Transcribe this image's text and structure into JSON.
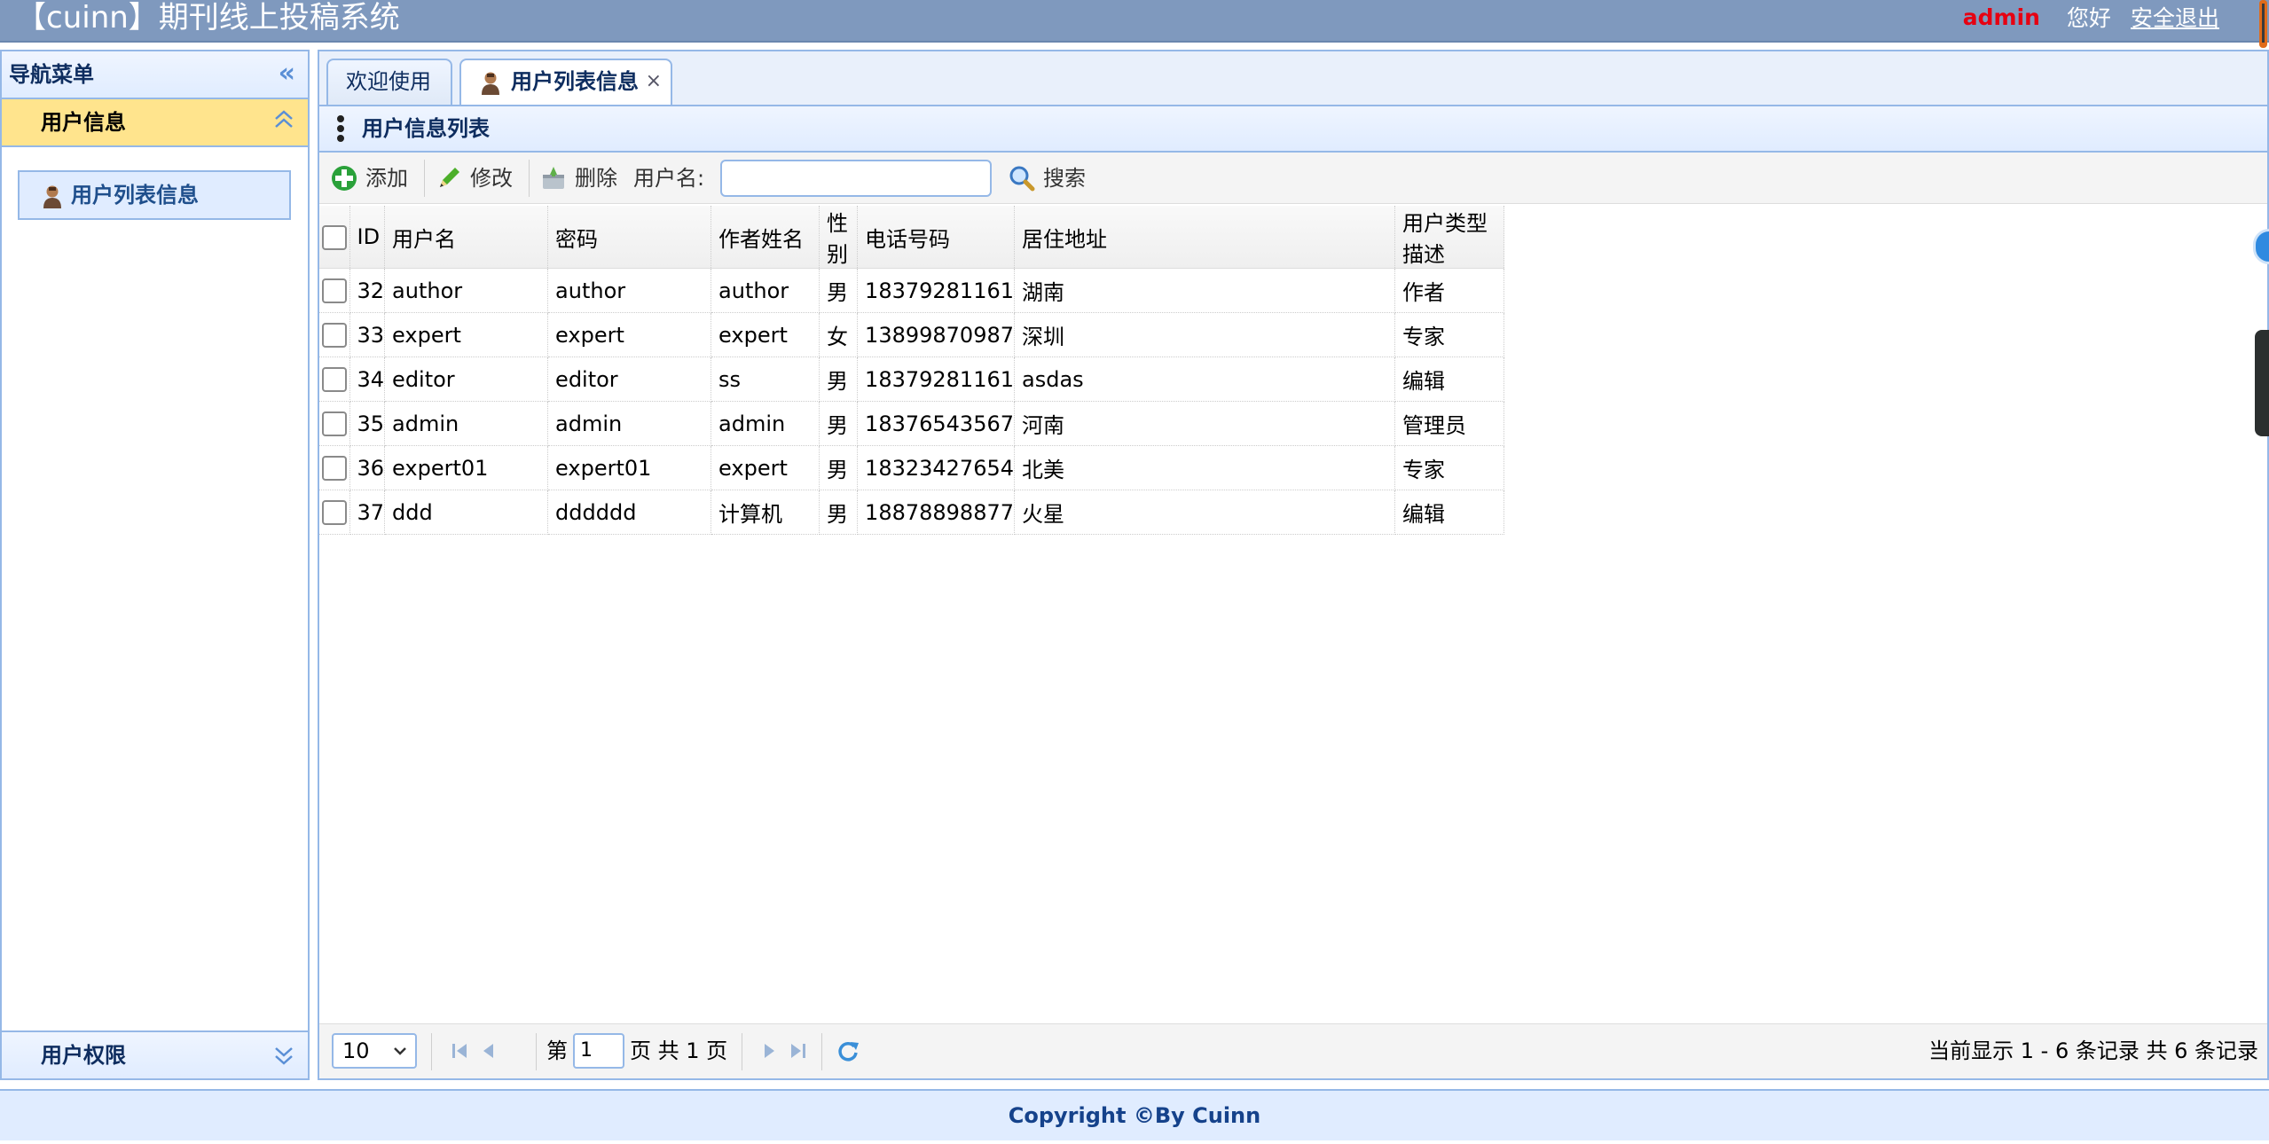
{
  "header": {
    "title": "【cuinn】期刊线上投稿系统",
    "user": "admin",
    "greeting": "您好",
    "logout": "安全退出"
  },
  "nav": {
    "title": "导航菜单",
    "sections": [
      {
        "label": "用户信息",
        "expanded": true,
        "items": [
          {
            "label": "用户列表信息",
            "icon": "user-icon"
          }
        ]
      },
      {
        "label": "用户权限",
        "expanded": false
      }
    ]
  },
  "tabs": [
    {
      "label": "欢迎使用",
      "active": false
    },
    {
      "label": "用户列表信息",
      "active": true,
      "icon": "user-icon",
      "closable": true
    }
  ],
  "panel": {
    "title": "用户信息列表",
    "toolbar": {
      "add": "添加",
      "edit": "修改",
      "delete": "删除",
      "username_label": "用户名:",
      "username_value": "",
      "search": "搜索"
    }
  },
  "grid": {
    "columns": [
      "ID",
      "用户名",
      "密码",
      "作者姓名",
      "性别",
      "电话号码",
      "居住地址",
      "用户类型描述"
    ],
    "rows": [
      [
        "32",
        "author",
        "author",
        "author",
        "男",
        "18379281161",
        "湖南",
        "作者"
      ],
      [
        "33",
        "expert",
        "expert",
        "expert",
        "女",
        "13899870987",
        "深圳",
        "专家"
      ],
      [
        "34",
        "editor",
        "editor",
        "ss",
        "男",
        "18379281161",
        "asdas",
        "编辑"
      ],
      [
        "35",
        "admin",
        "admin",
        "admin",
        "男",
        "18376543567",
        "河南",
        "管理员"
      ],
      [
        "36",
        "expert01",
        "expert01",
        "expert",
        "男",
        "18323427654",
        "北美",
        "专家"
      ],
      [
        "37",
        "ddd",
        "dddddd",
        "计算机",
        "男",
        "18878898877",
        "火星",
        "编辑"
      ]
    ]
  },
  "pager": {
    "page_size": "10",
    "page_prefix": "第",
    "page_value": "1",
    "page_total": "页 共 1 页",
    "info": "当前显示 1 - 6 条记录 共 6 条记录"
  },
  "footer": "Copyright ©By Cuinn",
  "colors": {
    "header_bg": "#7f99be",
    "panel_border": "#95b8e7",
    "accordion_active": "#ffe48d",
    "user_red": "#e60012",
    "footer_text": "#15428b"
  }
}
